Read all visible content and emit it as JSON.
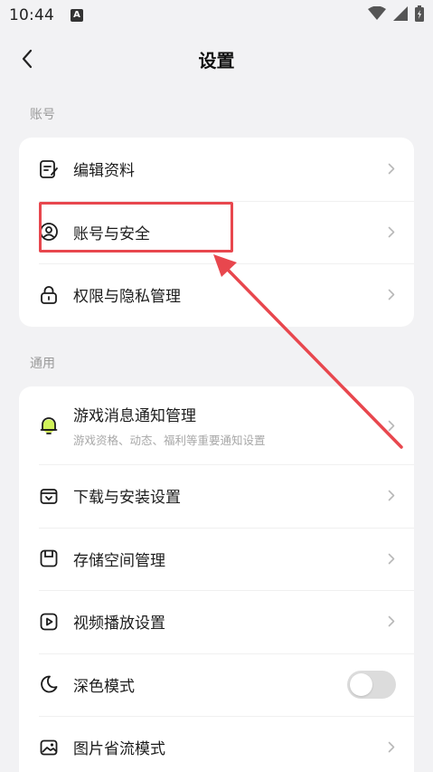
{
  "status_bar": {
    "time": "10:44",
    "notification_badge": "A",
    "icons": [
      "wifi-icon",
      "signal-icon",
      "battery-icon"
    ]
  },
  "header": {
    "title": "设置",
    "back_icon": "chevron-left-icon"
  },
  "sections": {
    "account": {
      "label": "账号",
      "items": [
        {
          "label": "编辑资料",
          "icon": "edit-profile-icon"
        },
        {
          "label": "账号与安全",
          "icon": "user-shield-icon"
        },
        {
          "label": "权限与隐私管理",
          "icon": "lock-icon"
        }
      ]
    },
    "general": {
      "label": "通用",
      "items": [
        {
          "label": "游戏消息通知管理",
          "sub": "游戏资格、动态、福利等重要通知设置",
          "icon": "bell-icon"
        },
        {
          "label": "下载与安装设置",
          "icon": "download-box-icon"
        },
        {
          "label": "存储空间管理",
          "icon": "storage-icon"
        },
        {
          "label": "视频播放设置",
          "icon": "play-icon"
        },
        {
          "label": "深色模式",
          "icon": "moon-icon",
          "toggle_on": false
        },
        {
          "label": "图片省流模式",
          "icon": "image-icon"
        }
      ]
    }
  },
  "colors": {
    "background": "#f2f2f4",
    "card": "#ffffff",
    "annotation": "#e8474e",
    "bell_accent": "#c8f03c"
  }
}
